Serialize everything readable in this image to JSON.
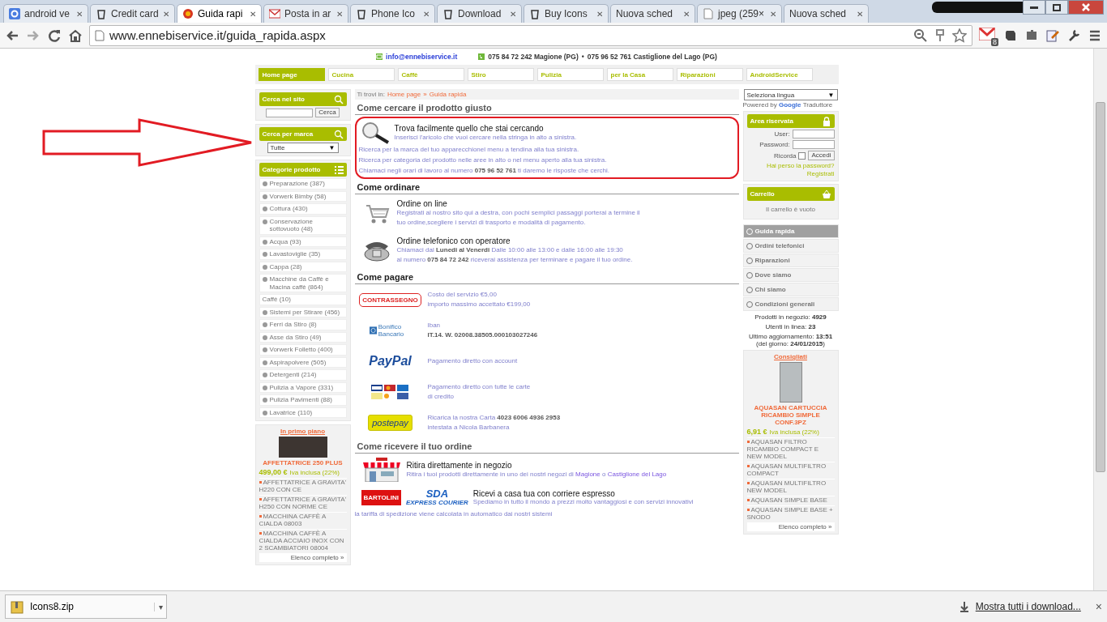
{
  "browser": {
    "tabs": [
      {
        "title": "android ve",
        "close": "✕",
        "selected": false
      },
      {
        "title": "Credit card",
        "close": "✕",
        "selected": false
      },
      {
        "title": "Guida rapi",
        "close": "✕",
        "selected": true
      },
      {
        "title": "Posta in ar",
        "close": "✕",
        "selected": false
      },
      {
        "title": "Phone Ico",
        "close": "✕",
        "selected": false
      },
      {
        "title": "Download",
        "close": "✕",
        "selected": false
      },
      {
        "title": "Buy Icons",
        "close": "✕",
        "selected": false
      },
      {
        "title": "Nuova sched",
        "close": "✕",
        "selected": false
      },
      {
        "title": "jpeg (259×",
        "close": "✕",
        "selected": false
      },
      {
        "title": "Nuova sched",
        "close": "✕",
        "selected": false
      }
    ],
    "address": "www.ennebiservice.it/guida_rapida.aspx",
    "mail_badge": "8"
  },
  "contact": {
    "email": "info@ennebiservice.it",
    "phone_1": "075 84 72 242 Magione (PG)",
    "separator": "•",
    "phone_2": "075 96 52 761 Castiglione del Lago (PG)"
  },
  "nav": [
    {
      "label": "Home page",
      "selected": true
    },
    {
      "label": "Cucina",
      "selected": false
    },
    {
      "label": "Caffè",
      "selected": false
    },
    {
      "label": "Stiro",
      "selected": false
    },
    {
      "label": "Pulizia",
      "selected": false
    },
    {
      "label": "per la Casa",
      "selected": false
    },
    {
      "label": "Riparazioni",
      "selected": false
    },
    {
      "label": "AndroidService",
      "selected": false
    }
  ],
  "left": {
    "search": {
      "title": "Cerca nel sito",
      "button": "Cerca"
    },
    "brand": {
      "title": "Cerca per marca",
      "select": "Tutte",
      "caret": "▼"
    },
    "categories": {
      "title": "Categorie prodotto",
      "items": [
        {
          "label": "Preparazione (387)",
          "kind": "bullet"
        },
        {
          "label": "Vorwerk Bimby (58)",
          "kind": "bullet"
        },
        {
          "label": "Cottura (430)",
          "kind": "bullet"
        },
        {
          "label": "Conservazione sottovuoto (48)",
          "kind": "bullet"
        },
        {
          "label": "Acqua (93)",
          "kind": "bullet"
        },
        {
          "label": "Lavastoviglie (35)",
          "kind": "bullet"
        },
        {
          "label": "Cappa (28)",
          "kind": "bullet"
        },
        {
          "label": "Macchine da Caffè e Macina caffè (864)",
          "kind": "bullet"
        },
        {
          "label": "Caffè (10)",
          "kind": "plain"
        },
        {
          "label": "Sistemi per Stirare (456)",
          "kind": "bullet"
        },
        {
          "label": "Ferri da Stiro (8)",
          "kind": "bullet"
        },
        {
          "label": "Asse da Stiro (49)",
          "kind": "bullet"
        },
        {
          "label": "Vorwerk Folletto (400)",
          "kind": "bullet"
        },
        {
          "label": "Aspirapolvere (505)",
          "kind": "bullet"
        },
        {
          "label": "Detergenti (214)",
          "kind": "bullet"
        },
        {
          "label": "Pulizia a Vapore (331)",
          "kind": "bullet"
        },
        {
          "label": "Pulizia Pavimenti (88)",
          "kind": "bullet"
        },
        {
          "label": "Lavatrice (110)",
          "kind": "bullet"
        }
      ]
    },
    "featured": {
      "title": "In primo piano",
      "product": "AFFETTATRICE 250 PLUS",
      "price": "499,00 €",
      "vat": "Iva inclusa (22%)",
      "links": [
        "AFFETTATRICE A GRAVITA' H220 CON CE",
        "AFFETTATRICE A GRAVITA' H250 CON NORME CE",
        "MACCHINA CAFFÈ A CIALDA 08003",
        "MACCHINA CAFFÈ A CIALDA ACCIAIO INOX CON 2 SCAMBIATORI 08004"
      ],
      "more": "Elenco completo »"
    }
  },
  "breadcrumb": {
    "label": "Ti trovi in:",
    "home": "Home page",
    "separator": "»",
    "current": "Guida rapida"
  },
  "search_help": {
    "heading": "Come cercare il prodotto giusto",
    "title": "Trova facilmente quello che stai cercando",
    "intro": "Inserisci l'aricolo che vuoi cercare nella stringa in alto a sinistra.",
    "lines": [
      "Ricerca per la marca del tuo apparecchionel menu a tendina alla tua sinistra.",
      "Ricerca per categoria del prodotto nelle aree in alto o nel menu aperto alla tua sinistra.",
      "Chiamaci negli orari di lavoro al numero **075 96 52 761** ti daremo le risposte che cerchi."
    ]
  },
  "ordering": {
    "heading": "Come ordinare",
    "items": [
      {
        "kind": "cart",
        "title": "Ordine on line",
        "lines": [
          "Registrati al nostro sito qui a destra, con pochi semplici passaggi porterai a termine il",
          "tuo ordine,scegliere i servizi di trasporto e modalità di pagamento."
        ]
      },
      {
        "kind": "phone",
        "title": "Ordine telefonico con operatore",
        "lines": [
          "Chiamaci dal **Lunedi al Venerdi** Dalle 10:00 alle 13:00 e dalle 16:00 alle 19:30",
          "al numero **075 84 72 242** riceverai assistenza per terminare e pagare il tuo ordine."
        ]
      }
    ]
  },
  "payment": {
    "heading": "Come pagare",
    "items": [
      {
        "kind": "cod",
        "logo": "CONTRASSEGNO",
        "lines": [
          {
            "text": "Costo del servizio €5,00",
            "bold": false
          },
          {
            "text": "importo massimo accettato €199,00",
            "bold": false
          }
        ]
      },
      {
        "kind": "bank",
        "logo": "Bonifico Bancario",
        "lines": [
          {
            "text": "Iban",
            "bold": false
          },
          {
            "text": "IT.14. W. 02008.38505.000103027246",
            "bold": true
          }
        ]
      },
      {
        "kind": "paypal",
        "logo": "PayPal",
        "lines": [
          {
            "text": "Pagamento diretto con account",
            "bold": false
          }
        ]
      },
      {
        "kind": "cards",
        "lines": [
          {
            "text": "Pagamento diretto con tutte le carte",
            "bold": false
          },
          {
            "text": "di credito",
            "bold": false
          }
        ]
      },
      {
        "kind": "postepay",
        "logo": "postepay",
        "lines": [
          {
            "text": "Ricarica la nostra Carta **4023 6006 4936 2953**",
            "bold": false
          },
          {
            "text": "intestata a Nicola Barbanera",
            "bold": false
          }
        ]
      }
    ]
  },
  "delivery": {
    "heading": "Come ricevere il tuo ordine",
    "pickup": {
      "title": "Ritira direttamente in negozio",
      "text": "Ritira i tuoi prodotti direttamente in uno dei nostri negozi di",
      "link_1": "Magione",
      "joiner": "o",
      "link_2": "Castiglione del Lago"
    },
    "courier": {
      "logo_1": "BARTOLINI",
      "logo_2": "SDA",
      "logo_2_sub": "EXPRESS COURIER",
      "title": "Ricevi a casa tua con corriere espresso",
      "text": "Spediamo in tutto il mondo a prezzi molto vantaggiosi e con servizi innovativi"
    },
    "note": "la tariffa di spedizione viene calcolata in automatico dai nostri sistemi"
  },
  "right": {
    "language": {
      "select": "Seleziona lingua",
      "caret": "▼",
      "powered": "Powered by",
      "google": "Google",
      "translate": "Traduttore"
    },
    "login": {
      "title": "Area riservata",
      "user": "User:",
      "password": "Password:",
      "remember": "Ricorda",
      "checked": false,
      "button": "Accedi",
      "lost": "Hai perso la password?",
      "register": "Registrati"
    },
    "cart": {
      "title": "Carrello",
      "empty": "Il carrello è vuoto"
    },
    "menu": [
      {
        "label": "Guida rapida",
        "selected": true
      },
      {
        "label": "Ordini telefonici",
        "selected": false
      },
      {
        "label": "Riparazioni",
        "selected": false
      },
      {
        "label": "Dove siamo",
        "selected": false
      },
      {
        "label": "Chi siamo",
        "selected": false
      },
      {
        "label": "Condizioni generali",
        "selected": false
      }
    ],
    "stats": [
      "Prodotti in negozio: **4929**",
      "Utenti in linea: **23**",
      "Ultimo aggiornamento: **13:51** (del giorno: **24/01/2015**)"
    ],
    "featured": {
      "title": "Consigliati",
      "product": "AQUASAN CARTUCCIA RICAMBIO SIMPLE CONF.3PZ",
      "price": "6,91 €",
      "vat": "Iva inclusa (22%)",
      "links": [
        "AQUASAN FILTRO RICAMBIO COMPACT E NEW MODEL",
        "AQUASAN MULTIFILTRO COMPACT",
        "AQUASAN MULTIFILTRO NEW MODEL",
        "AQUASAN SIMPLE BASE",
        "AQUASAN SIMPLE BASE + SNODO"
      ],
      "more": "Elenco completo »"
    }
  },
  "downloads": {
    "file": "Icons8.zip",
    "caret": "▾",
    "show_all": "Mostra tutti i download...",
    "close": "×"
  }
}
